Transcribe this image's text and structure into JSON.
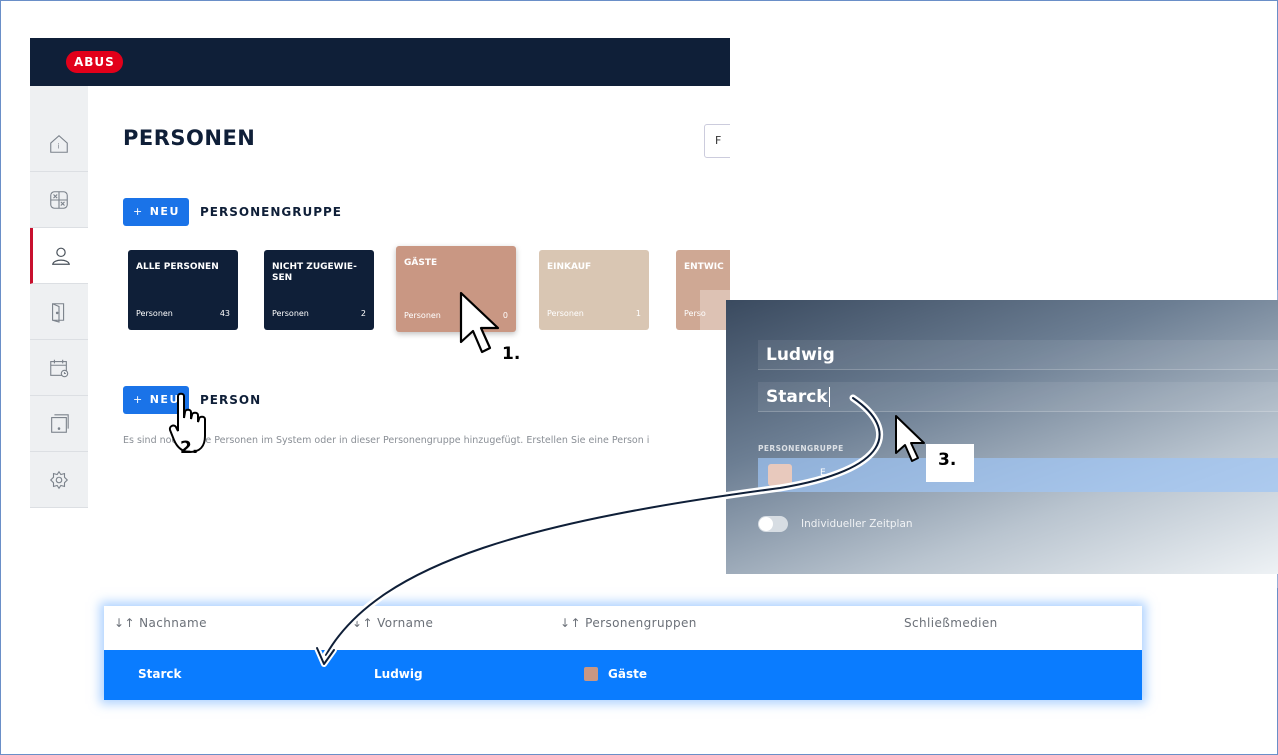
{
  "app": {
    "logo": "ABUS",
    "page_title": "PERSONEN",
    "top_button_label": "F",
    "sidebar": [
      {
        "icon": "home-icon"
      },
      {
        "icon": "grid-x-icon"
      },
      {
        "icon": "user-icon",
        "active": true
      },
      {
        "icon": "door-icon"
      },
      {
        "icon": "calendar-clock-icon"
      },
      {
        "icon": "device-icon"
      },
      {
        "icon": "settings-icon"
      }
    ],
    "new_group": {
      "button": "NEU",
      "label": "PERSONENGRUPPE"
    },
    "groups": [
      {
        "name": "ALLE PERSONEN",
        "footer_label": "Personen",
        "count": "43"
      },
      {
        "name": "NICHT ZUGEWIE-SEN",
        "footer_label": "Personen",
        "count": "2"
      },
      {
        "name": "GÄSTE",
        "footer_label": "Personen",
        "count": "0"
      },
      {
        "name": "EINKAUF",
        "footer_label": "Personen",
        "count": "1"
      },
      {
        "name": "ENTWIC",
        "footer_label": "Perso",
        "count": ""
      }
    ],
    "new_person": {
      "button": "NEU",
      "label": "PERSON"
    },
    "empty_text": "Es sind noch keine Personen im System oder in dieser Personengruppe hinzugefügt. Erstellen Sie eine Person i"
  },
  "steps": {
    "one": "1.",
    "two": "2.",
    "three": "3."
  },
  "form": {
    "first_name": "Ludwig",
    "last_name": "Starck",
    "group_label": "PERSONENGRUPPE",
    "group_value": "E",
    "toggle_label": "Individueller Zeitplan"
  },
  "table": {
    "headers": [
      "↓↑ Nachname",
      "↓↑ Vorname",
      "↓↑ Personengruppen",
      "Schließmedien"
    ],
    "row": {
      "nachname": "Starck",
      "vorname": "Ludwig",
      "gruppe": "Gäste",
      "gruppe_color": "#c99783"
    }
  },
  "colors": {
    "navy": "#0f1f38",
    "accent": "#1a73e8",
    "highlight": "#0a7cff",
    "brand_red": "#e2001a"
  }
}
